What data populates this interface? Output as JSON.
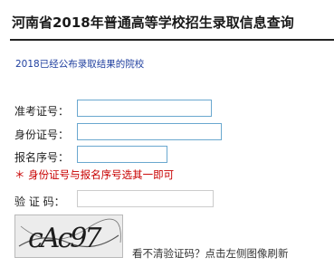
{
  "header": {
    "title": "河南省2018年普通高等学校招生录取信息查询"
  },
  "links": {
    "published_colleges": "2018已经公布录取结果的院校"
  },
  "form": {
    "exam_no_label": "准考证号：",
    "exam_no_value": "",
    "id_no_label": "身份证号：",
    "id_no_value": "",
    "reg_no_label": "报名序号：",
    "reg_no_value": "",
    "note": "＊ 身份证号与报名序号选其一即可",
    "captcha_label": "验 证 码：",
    "captcha_value": ""
  },
  "captcha": {
    "text": "cAc97",
    "hint": "看不清验证码？点击左侧图像刷新"
  },
  "colors": {
    "title": "#1a1a1a",
    "link": "#1f3f9f",
    "note": "#c80000",
    "input_border": "#6aa8cf"
  }
}
